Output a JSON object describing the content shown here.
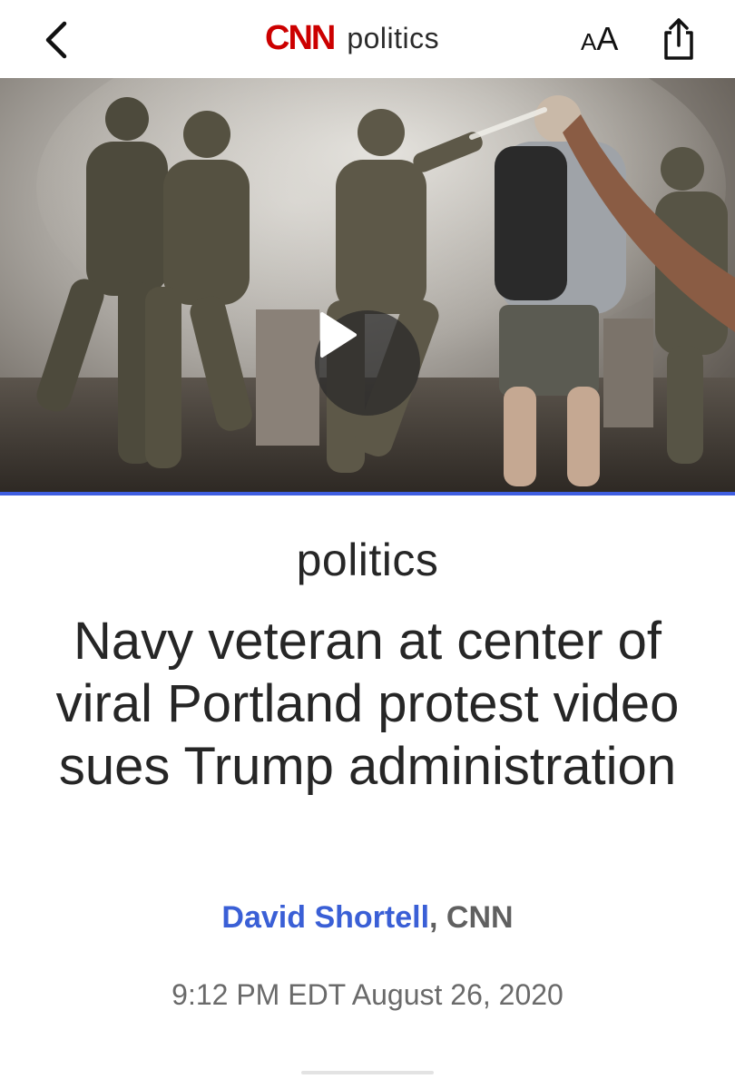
{
  "nav": {
    "brand_logo": "CNN",
    "brand_section": "politics",
    "text_size_small": "A",
    "text_size_large": "A",
    "icons": [
      "chevron-left-icon",
      "share-icon"
    ],
    "brand_color": "#cc0000"
  },
  "media": {
    "type": "video",
    "play_icon": "play-icon",
    "accent_rule_color": "#3f5ee0"
  },
  "article": {
    "section_label": "politics",
    "headline": "Navy veteran at center of viral Portland protest video sues Trump administration",
    "author": "David Shortell",
    "byline_separator": ",",
    "organization": "CNN",
    "timestamp": "9:12 PM EDT August 26, 2020",
    "author_color": "#3a5fd6"
  }
}
